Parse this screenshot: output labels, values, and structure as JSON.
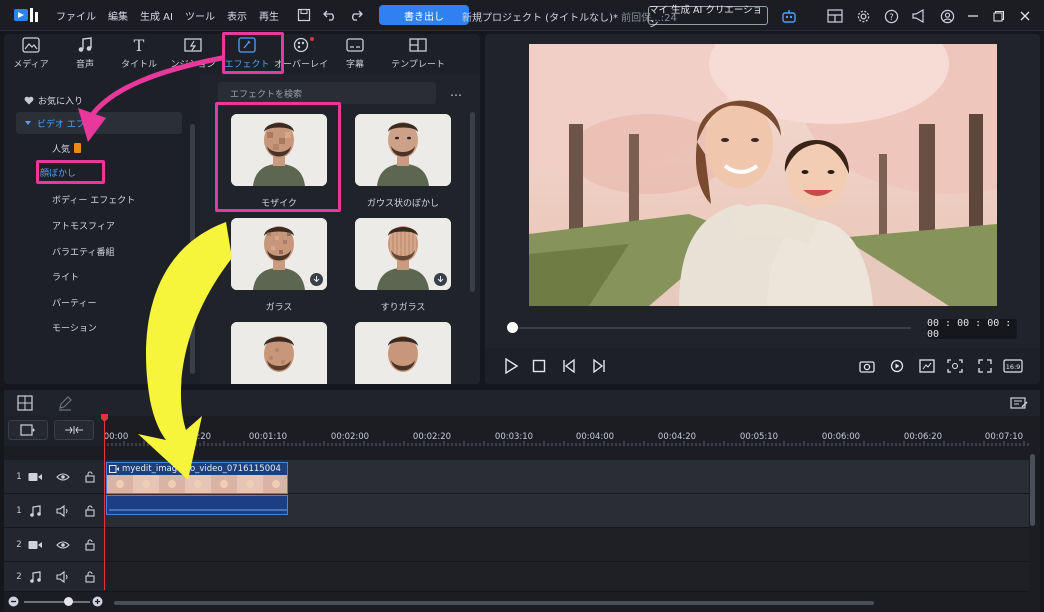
{
  "menubar": {
    "items": [
      "ファイル",
      "編集",
      "生成 AI",
      "ツール",
      "表示",
      "再生"
    ],
    "export_label": "書き出し",
    "project_title": "新規プロジェクト (タイトルなし)*",
    "project_subtitle": "前回保...:24",
    "ai_creation_label": "マイ 生成 AI クリエーション"
  },
  "tabs": [
    {
      "label": "メディア"
    },
    {
      "label": "音声"
    },
    {
      "label": "タイトル"
    },
    {
      "label": "ンジション"
    },
    {
      "label": "エフェクト"
    },
    {
      "label": "オーバーレイ"
    },
    {
      "label": "字幕"
    },
    {
      "label": "テンプレート"
    }
  ],
  "categories": {
    "favorites": "お気に入り",
    "parent": "ビデオ エフェ",
    "children": [
      "人気",
      "顔ぼかし",
      "ボディー エフェクト",
      "アトモスフィア",
      "バラエティ番組",
      "ライト",
      "パーティー",
      "モーション"
    ]
  },
  "effects": {
    "search_placeholder": "エフェクトを検索",
    "more": "…",
    "items": [
      {
        "label": "モザイク"
      },
      {
        "label": "ガウス状のぼかし"
      },
      {
        "label": "ガラス"
      },
      {
        "label": "すりガラス"
      },
      {
        "label": ""
      },
      {
        "label": ""
      }
    ]
  },
  "preview": {
    "timecode": "00 : 00 : 00 : 00",
    "progress": 0,
    "aspect_label": "16:9"
  },
  "timeline": {
    "ruler_labels": [
      "00:00",
      "00:00:20",
      "00:01:10",
      "00:02:00",
      "00:02:20",
      "00:03:10",
      "00:04:00",
      "00:04:20",
      "00:05:10",
      "00:06:00",
      "00:06:20",
      "00:07:10"
    ],
    "tracks": [
      {
        "num": "1",
        "type": "video"
      },
      {
        "num": "1",
        "type": "audio"
      },
      {
        "num": "2",
        "type": "video"
      },
      {
        "num": "2",
        "type": "audio"
      }
    ],
    "clip_title": "myedit_image_to_video_0716115004"
  },
  "colors": {
    "accent": "#4ea1ff",
    "export": "#2f80f0",
    "highlight_pink": "#e8389c",
    "arrow_yellow": "#f6f43b",
    "playhead": "#e0353d"
  }
}
